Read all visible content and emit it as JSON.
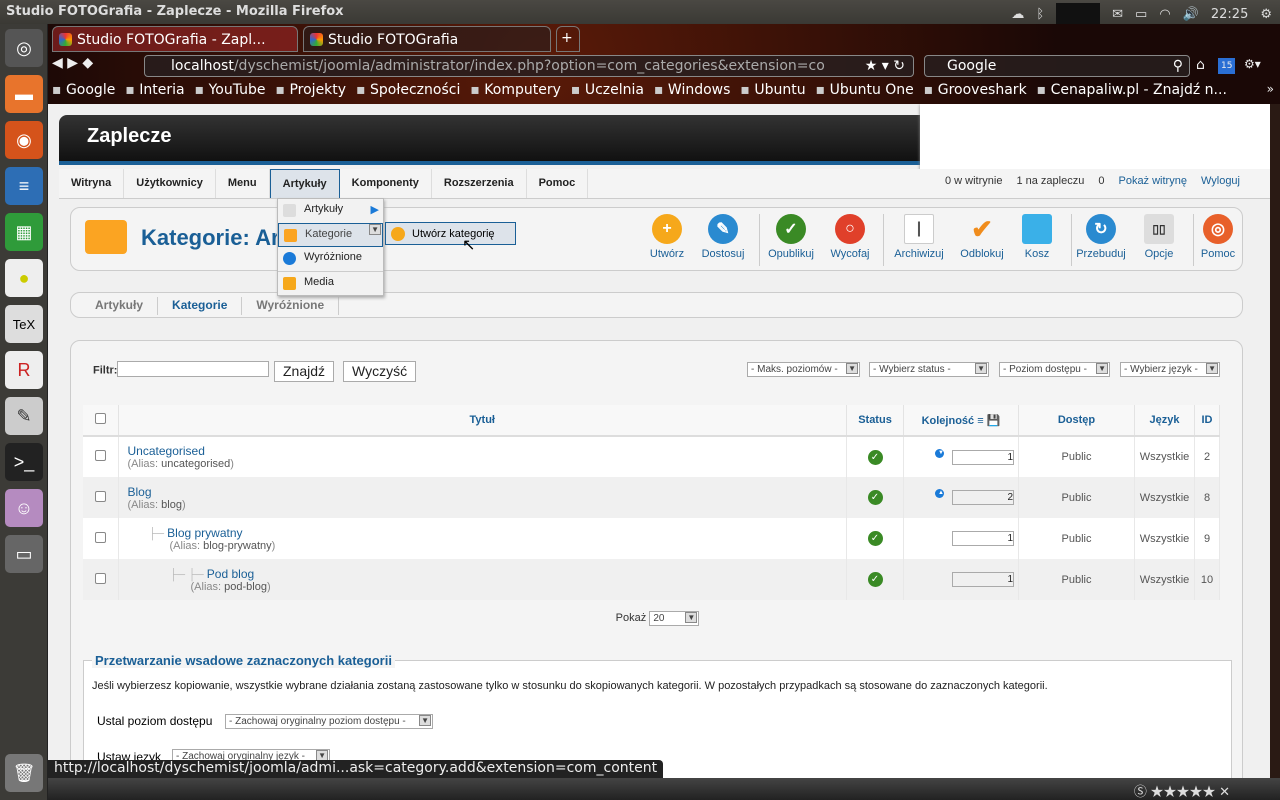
{
  "os": {
    "window_title": "Studio FOTOGrafia - Zaplecze - Mozilla Firefox",
    "clock": "22:25"
  },
  "browser": {
    "tabs": [
      {
        "label": "Studio FOTOGrafia - Zapl..."
      },
      {
        "label": "Studio FOTOGrafia"
      }
    ],
    "url_host": "localhost",
    "url_path": "/dyschemist/joomla/administrator/index.php?option=com_categories&extension=co",
    "search_engine": "Google",
    "calendar_badge": "15",
    "bookmarks": [
      "Google",
      "Interia",
      "YouTube",
      "Projekty",
      "Społeczności",
      "Komputery",
      "Uczelnia",
      "Windows",
      "Ubuntu",
      "Ubuntu One",
      "Grooveshark",
      "Cenapaliw.pl - Znajdź n..."
    ],
    "status_url": "http://localhost/dyschemist/joomla/admi...ask=category.add&extension=com_content"
  },
  "admin": {
    "header_title": "Zaplecze",
    "menu": [
      "Witryna",
      "Użytkownicy",
      "Menu",
      "Artykuły",
      "Komponenty",
      "Rozszerzenia",
      "Pomoc"
    ],
    "status": {
      "site_users": "0 w witrynie",
      "admin_users": "1 na zapleczu",
      "messages": "0",
      "view_site": "Pokaż witrynę",
      "logout": "Wyloguj"
    },
    "dropdown": [
      "Artykuły",
      "Kategorie",
      "Wyróżnione",
      "Media"
    ],
    "submenu_item": "Utwórz kategorię",
    "page_title": "Kategorie: Artykuły",
    "toolbar": [
      "Utwórz",
      "Dostosuj",
      "Opublikuj",
      "Wycofaj",
      "Archiwizuj",
      "Odblokuj",
      "Kosz",
      "Przebuduj",
      "Opcje",
      "Pomoc"
    ],
    "subnav": [
      "Artykuły",
      "Kategorie",
      "Wyróżnione"
    ],
    "filter": {
      "label": "Filtr:",
      "value": "",
      "search": "Znajdź",
      "clear": "Wyczyść",
      "selects": [
        "- Maks. poziomów -",
        "- Wybierz status -",
        "- Poziom dostępu -",
        "- Wybierz język -"
      ]
    },
    "table": {
      "headers": [
        "Tytuł",
        "Status",
        "Kolejność",
        "Dostęp",
        "Język",
        "ID"
      ],
      "alias_label": "Alias",
      "rows": [
        {
          "title": "Uncategorised",
          "alias": "uncategorised",
          "order": "1",
          "access": "Public",
          "lang": "Wszystkie",
          "id": "2",
          "level": 0,
          "arrow": "down"
        },
        {
          "title": "Blog",
          "alias": "blog",
          "order": "2",
          "access": "Public",
          "lang": "Wszystkie",
          "id": "8",
          "level": 0,
          "arrow": "up"
        },
        {
          "title": "Blog prywatny",
          "alias": "blog-prywatny",
          "order": "1",
          "access": "Public",
          "lang": "Wszystkie",
          "id": "9",
          "level": 1,
          "arrow": ""
        },
        {
          "title": "Pod blog",
          "alias": "pod-blog",
          "order": "1",
          "access": "Public",
          "lang": "Wszystkie",
          "id": "10",
          "level": 2,
          "arrow": ""
        }
      ]
    },
    "pagination": {
      "label": "Pokaż",
      "value": "20"
    },
    "batch": {
      "legend": "Przetwarzanie wsadowe zaznaczonych kategorii",
      "description": "Jeśli wybierzesz kopiowanie, wszystkie wybrane działania zostaną zastosowane tylko w stosunku do skopiowanych kategorii. W pozostałych przypadkach są stosowane do zaznaczonych kategorii.",
      "access_label": "Ustal poziom dostępu",
      "access_value": "- Zachowaj oryginalny poziom dostępu -",
      "lang_label": "Ustaw język",
      "lang_value": "- Zachowaj oryginalny język -"
    }
  },
  "colors": {
    "accent": "#1a5f96",
    "ok": "#3a8a25"
  }
}
